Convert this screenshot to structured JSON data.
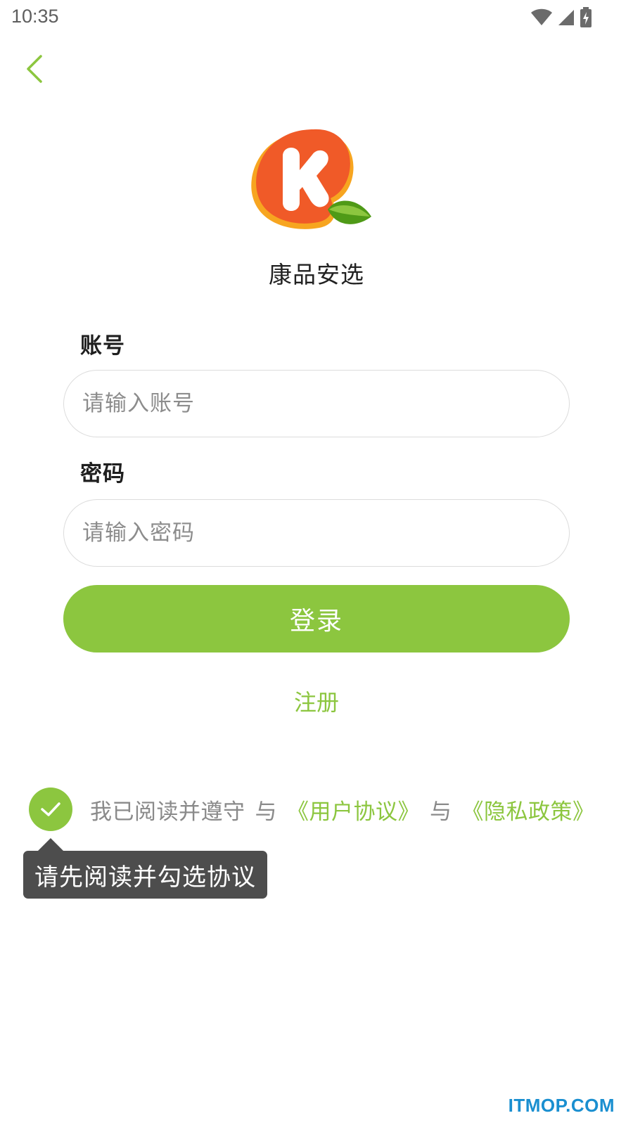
{
  "status_bar": {
    "time": "10:35",
    "icons": [
      "wifi-icon",
      "signal-icon",
      "battery-charging-icon"
    ]
  },
  "header": {
    "back_icon": "chevron-left-icon"
  },
  "brand": {
    "logo_letter": "K",
    "app_name": "康品安选"
  },
  "form": {
    "account_label": "账号",
    "account_placeholder": "请输入账号",
    "account_value": "",
    "password_label": "密码",
    "password_placeholder": "请输入密码",
    "password_value": "",
    "login_label": "登录",
    "register_label": "注册"
  },
  "agreement": {
    "checked": true,
    "prefix": "我已阅读并遵守",
    "and_1": "与",
    "user_agreement": "《用户协议》",
    "and_2": "与",
    "privacy_policy": "《隐私政策》"
  },
  "tooltip": {
    "text": "请先阅读并勾选协议"
  },
  "watermark": {
    "text": "ITMOP.COM"
  },
  "colors": {
    "accent": "#8cc63f",
    "tooltip_bg": "#4d4d4d",
    "logo_orange": "#f05a28",
    "logo_yellow": "#f7a520",
    "leaf_green": "#4f9a17",
    "watermark": "#1a8fd0"
  }
}
